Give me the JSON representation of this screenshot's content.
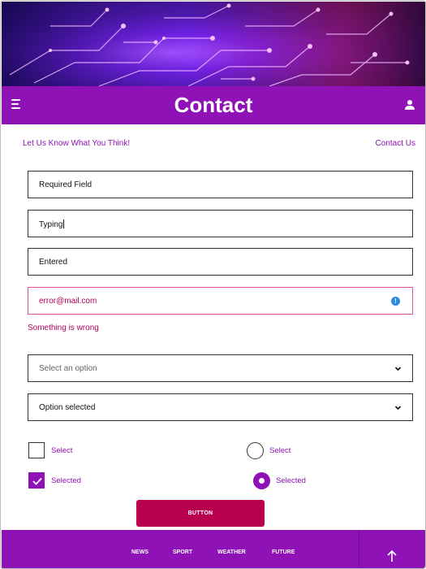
{
  "header": {
    "title": "Contact",
    "menu_icon": "hamburger-menu-icon",
    "account_icon": "user-icon"
  },
  "subbar": {
    "left_text": "Let Us Know What You Think!",
    "right_link": "Contact Us"
  },
  "form": {
    "fields": [
      {
        "value": "Required Field",
        "state": "default"
      },
      {
        "value": "Typing",
        "state": "focused"
      },
      {
        "value": "Entered",
        "state": "filled"
      },
      {
        "value": "error@mail.com",
        "state": "error"
      }
    ],
    "error_message": "Something is wrong",
    "selects": [
      {
        "value": "Select an option",
        "placeholder": true
      },
      {
        "value": "Option selected",
        "placeholder": false
      }
    ],
    "checkboxes": [
      {
        "label": "Select",
        "checked": false
      },
      {
        "label": "Selected",
        "checked": true
      }
    ],
    "radios": [
      {
        "label": "Select",
        "checked": false
      },
      {
        "label": "Selected",
        "checked": true
      }
    ],
    "button_label": "BUTTON"
  },
  "footer": {
    "nav": [
      "NEWS",
      "SPORT",
      "WEATHER",
      "FUTURE"
    ],
    "back_to_top_icon": "arrow-up-icon"
  },
  "colors": {
    "brand_purple": "#8e12b5",
    "button": "#b8004f",
    "error": "#b0005a",
    "info": "#2a8de0"
  }
}
